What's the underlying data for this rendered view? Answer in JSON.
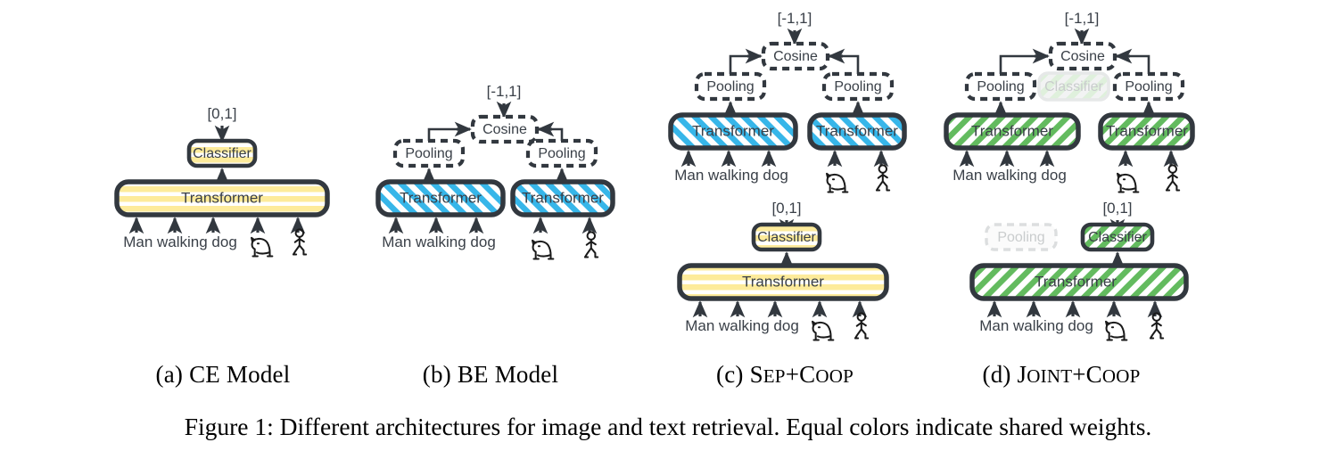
{
  "figure": {
    "caption": "Figure 1: Different architectures for image and text retrieval. Equal colors indicate shared weights.",
    "background_color": "#ffffff",
    "outline_color": "#32383f",
    "text_color": "#3a4048",
    "ghost_color": "#cfd2d4",
    "colors": {
      "yellow": "#fdeb9b",
      "blue": "#37b6e9",
      "green": "#63bb5f",
      "ghost_green": "#dff0dc",
      "ghost_grey": "#e3e5e6"
    }
  },
  "panels": [
    {
      "id": "a",
      "caption_prefix": "(a)",
      "caption_text": "CE Model",
      "caption_small": null,
      "fill": "yellow",
      "pattern": "horizontal-stripes",
      "blocks": [
        {
          "name": "transformer",
          "label": "Transformer"
        },
        {
          "name": "classifier",
          "label": "Classifier"
        }
      ],
      "outputs": [
        {
          "name": "output-range",
          "label": "[0,1]"
        }
      ],
      "inputs": [
        {
          "name": "text-input",
          "label": "Man walking dog"
        }
      ],
      "icons": [
        "dog-icon",
        "person-walking-icon"
      ]
    },
    {
      "id": "b",
      "caption_prefix": "(b)",
      "caption_text": "BE Model",
      "caption_small": null,
      "fill": "blue",
      "pattern": "diagonal-stripes-forward",
      "blocks": [
        {
          "name": "transformer-text",
          "label": "Transformer"
        },
        {
          "name": "transformer-image",
          "label": "Transformer"
        },
        {
          "name": "pooling-text",
          "label": "Pooling"
        },
        {
          "name": "pooling-image",
          "label": "Pooling"
        },
        {
          "name": "cosine",
          "label": "Cosine"
        }
      ],
      "outputs": [
        {
          "name": "output-range",
          "label": "[-1,1]"
        }
      ],
      "inputs": [
        {
          "name": "text-input",
          "label": "Man walking dog"
        }
      ],
      "icons": [
        "dog-icon",
        "person-walking-icon"
      ]
    },
    {
      "id": "c",
      "caption_prefix": "(c)",
      "caption_text": "S",
      "caption_small": "EP",
      "caption_text2": "+C",
      "caption_small2": "OOP",
      "fill": "blue",
      "pattern": "diagonal-stripes-forward",
      "blocks": [
        {
          "name": "transformer-text",
          "label": "Transformer"
        },
        {
          "name": "transformer-image",
          "label": "Transformer"
        },
        {
          "name": "pooling-text",
          "label": "Pooling"
        },
        {
          "name": "pooling-image",
          "label": "Pooling"
        },
        {
          "name": "cosine",
          "label": "Cosine"
        },
        {
          "name": "transformer-joint",
          "label": "Transformer"
        },
        {
          "name": "classifier",
          "label": "Classifier"
        }
      ],
      "outputs": [
        {
          "name": "output-range-top",
          "label": "[-1,1]"
        },
        {
          "name": "output-range-bottom",
          "label": "[0,1]"
        }
      ],
      "inputs": [
        {
          "name": "text-input-top",
          "label": "Man walking dog"
        },
        {
          "name": "text-input-bottom",
          "label": "Man walking dog"
        }
      ],
      "icons": [
        "dog-icon",
        "person-walking-icon"
      ]
    },
    {
      "id": "d",
      "caption_prefix": "(d)",
      "caption_text": "J",
      "caption_small": "OINT",
      "caption_text2": "+C",
      "caption_small2": "OOP",
      "fill": "green",
      "pattern": "diagonal-stripes-back",
      "blocks": [
        {
          "name": "transformer-text",
          "label": "Transformer"
        },
        {
          "name": "transformer-image",
          "label": "Transformer"
        },
        {
          "name": "pooling-text",
          "label": "Pooling"
        },
        {
          "name": "pooling-image",
          "label": "Pooling"
        },
        {
          "name": "cosine",
          "label": "Cosine"
        },
        {
          "name": "classifier-ghost",
          "label": "Classifier"
        },
        {
          "name": "transformer-joint",
          "label": "Transformer"
        },
        {
          "name": "classifier",
          "label": "Classifier"
        },
        {
          "name": "pooling-ghost",
          "label": "Pooling"
        }
      ],
      "outputs": [
        {
          "name": "output-range-top",
          "label": "[-1,1]"
        },
        {
          "name": "output-range-bottom",
          "label": "[0,1]"
        }
      ],
      "inputs": [
        {
          "name": "text-input-top",
          "label": "Man walking dog"
        },
        {
          "name": "text-input-bottom",
          "label": "Man walking dog"
        }
      ],
      "icons": [
        "dog-icon",
        "person-walking-icon"
      ]
    }
  ],
  "labels": {
    "transformer": "Transformer",
    "classifier": "Classifier",
    "pooling": "Pooling",
    "cosine": "Cosine",
    "range_unit": "[0,1]",
    "range_cosine": "[-1,1]",
    "text_input": "Man walking dog"
  },
  "captions": {
    "a": {
      "prefix": "(a)",
      "main": "CE Model"
    },
    "b": {
      "prefix": "(b)",
      "main": "BE Model"
    },
    "c": {
      "prefix": "(c)",
      "p1": "S",
      "s1": "EP",
      "p2": "+C",
      "s2": "OOP"
    },
    "d": {
      "prefix": "(d)",
      "p1": "J",
      "s1": "OINT",
      "p2": "+C",
      "s2": "OOP"
    }
  }
}
